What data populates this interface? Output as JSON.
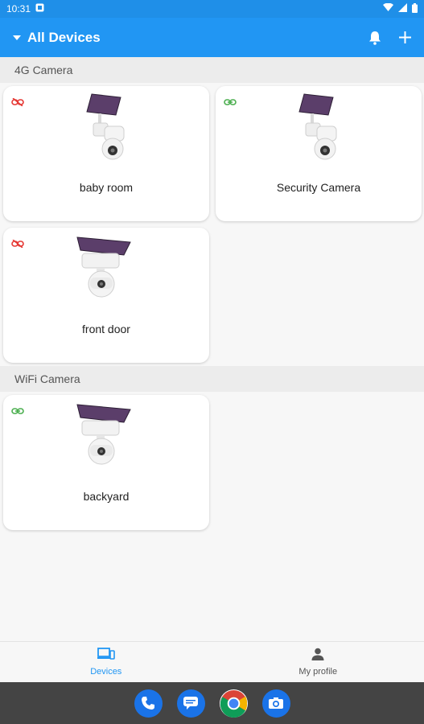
{
  "status_bar": {
    "time": "10:31"
  },
  "app_bar": {
    "title": "All Devices"
  },
  "sections": [
    {
      "title": "4G Camera",
      "devices": [
        {
          "name": "baby room",
          "status": "offline"
        },
        {
          "name": "Security Camera",
          "status": "online"
        },
        {
          "name": "front door",
          "status": "offline"
        }
      ]
    },
    {
      "title": "WiFi Camera",
      "devices": [
        {
          "name": "backyard",
          "status": "online"
        }
      ]
    }
  ],
  "bottom_nav": {
    "devices_label": "Devices",
    "profile_label": "My profile"
  },
  "colors": {
    "accent": "#2196f3",
    "online": "#4caf50",
    "offline": "#e53935"
  }
}
